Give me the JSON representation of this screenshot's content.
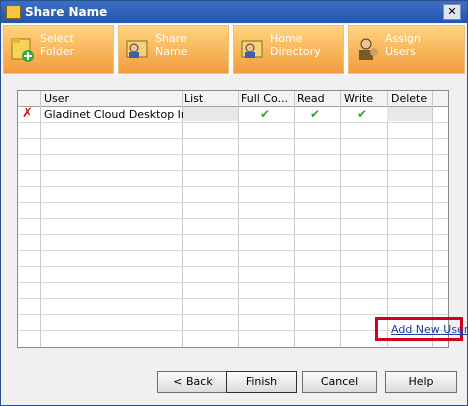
{
  "window": {
    "title": "Share Name",
    "close_glyph": "✕"
  },
  "toolbar": {
    "items": [
      {
        "label": "Select\nFolder",
        "icon": "folder-add-icon"
      },
      {
        "label": "Share\nName",
        "icon": "share-folder-icon"
      },
      {
        "label": "Home\nDirectory",
        "icon": "home-directory-icon"
      },
      {
        "label": "Assign\nUsers",
        "icon": "assign-users-icon"
      }
    ],
    "gradient_top": "#ffd47e",
    "gradient_bottom": "#f39b3d"
  },
  "grid": {
    "columns": [
      "User",
      "List",
      "Full Co...",
      "Read",
      "Write",
      "Delete"
    ],
    "rows": [
      {
        "user": "Gladinet Cloud Desktop In...",
        "full_control": "✔",
        "read": "✔",
        "write": "✔",
        "remove": "✗"
      }
    ]
  },
  "add_user": {
    "label": "Add New User"
  },
  "buttons": {
    "back": "< Back",
    "finish": "Finish",
    "cancel": "Cancel",
    "help": "Help"
  }
}
